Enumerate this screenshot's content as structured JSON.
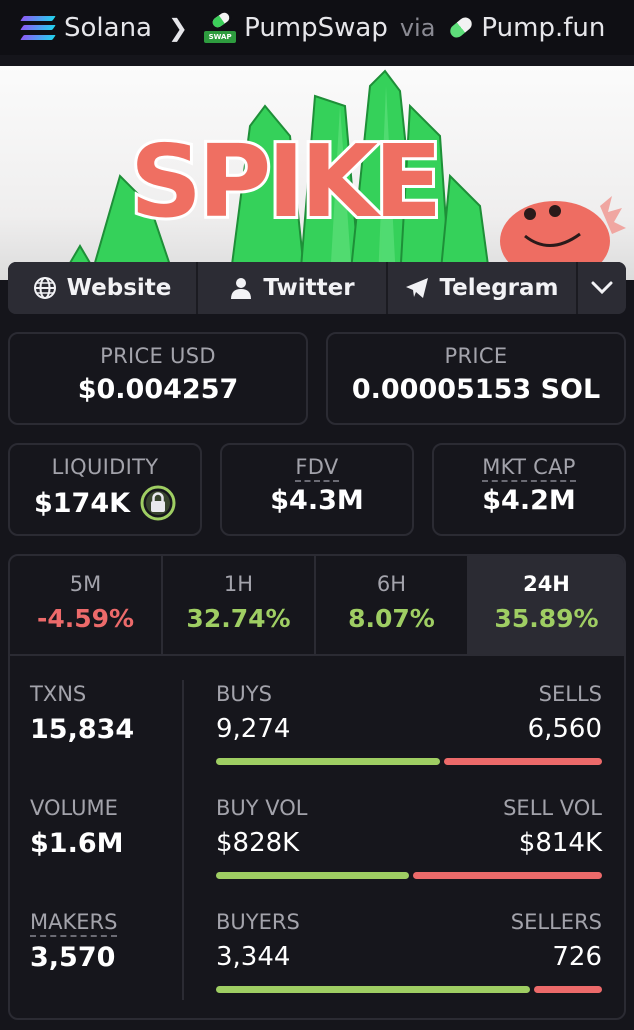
{
  "breadcrumb": {
    "chain": "Solana",
    "dex": "PumpSwap",
    "via_label": "via",
    "launchpad": "Pump.fun",
    "dex_logo_tag": "SWAP"
  },
  "banner": {
    "token_art_text": "SPIKE"
  },
  "links": {
    "website": "Website",
    "twitter": "Twitter",
    "telegram": "Telegram"
  },
  "price": {
    "usd_label": "PRICE USD",
    "usd_value": "$0.004257",
    "native_label": "PRICE",
    "native_value": "0.00005153 SOL"
  },
  "metrics": {
    "liquidity_label": "LIQUIDITY",
    "liquidity_value": "$174K",
    "fdv_label": "FDV",
    "fdv_value": "$4.3M",
    "mcap_label": "MKT CAP",
    "mcap_value": "$4.2M"
  },
  "timeframes": [
    {
      "label": "5M",
      "change": "-4.59%",
      "direction": "down"
    },
    {
      "label": "1H",
      "change": "32.74%",
      "direction": "up"
    },
    {
      "label": "6H",
      "change": "8.07%",
      "direction": "up"
    },
    {
      "label": "24H",
      "change": "35.89%",
      "direction": "up",
      "selected": true
    }
  ],
  "stats": {
    "txns_label": "TXNS",
    "txns_value": "15,834",
    "volume_label": "VOLUME",
    "volume_value": "$1.6M",
    "makers_label": "MAKERS",
    "makers_value": "3,570",
    "buys_label": "BUYS",
    "buys_value": "9,274",
    "sells_label": "SELLS",
    "sells_value": "6,560",
    "buys_share": 0.586,
    "buyvol_label": "BUY VOL",
    "buyvol_value": "$828K",
    "sellvol_label": "SELL VOL",
    "sellvol_value": "$814K",
    "buyvol_share": 0.504,
    "buyers_label": "BUYERS",
    "buyers_value": "3,344",
    "sellers_label": "SELLERS",
    "sellers_value": "726",
    "buyers_share": 0.822
  },
  "colors": {
    "positive": "#9fce63",
    "negative": "#ec6a6a",
    "background": "#15151b"
  }
}
